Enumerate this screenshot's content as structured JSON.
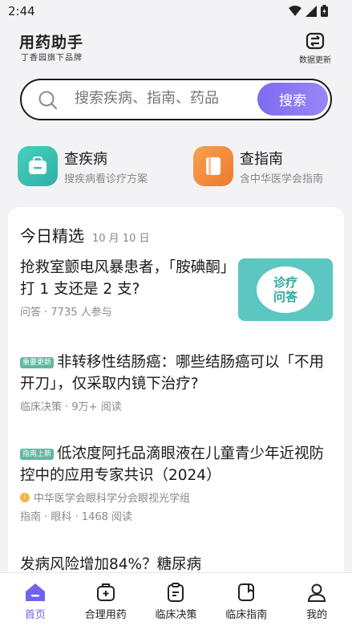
{
  "status": {
    "time": "2:44"
  },
  "header": {
    "title": "用药助手",
    "subtitle": "丁香园旗下品牌",
    "update_label": "数据更新"
  },
  "search": {
    "placeholder": "搜索疾病、指南、药品",
    "button_label": "搜索"
  },
  "quick_links": [
    {
      "title": "查疾病",
      "desc": "搜疾病看诊疗方案",
      "color": "#3cc1b0"
    },
    {
      "title": "查指南",
      "desc": "含中华医学会指南",
      "color": "#f08a3c"
    }
  ],
  "feed": {
    "title": "今日精选",
    "date": "10 月 10 日",
    "articles": [
      {
        "title": "抢救室颤电风暴患者，「胺碘酮」打 1 支还是 2 支?",
        "meta": "问答 · 7735 人参与",
        "thumb_text": "诊疗问答"
      },
      {
        "badge": "重要更新",
        "title": "非转移性结肠癌：哪些结肠癌可以「不用开刀」，仅采取内镜下治疗?",
        "meta": "临床决策 · 9万+ 阅读"
      },
      {
        "badge": "指南上新",
        "title": "低浓度阿托品滴眼液在儿童青少年近视防控中的应用专家共识（2024）",
        "author": "中华医学会眼科学分会眼视光学组",
        "meta": "指南 · 眼科 · 1468 阅读"
      },
      {
        "title": "发病风险增加84%？糖尿病"
      }
    ]
  },
  "tabs": [
    {
      "label": "首页",
      "icon": "home-icon",
      "active": true
    },
    {
      "label": "合理用药",
      "icon": "medkit-icon"
    },
    {
      "label": "临床决策",
      "icon": "clipboard-icon"
    },
    {
      "label": "临床指南",
      "icon": "book-icon"
    },
    {
      "label": "我的",
      "icon": "user-icon"
    }
  ],
  "colors": {
    "accent": "#6f63ee"
  }
}
